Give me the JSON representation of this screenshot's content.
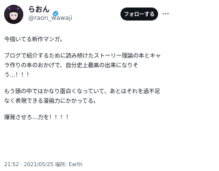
{
  "user": {
    "display_name": "らおん",
    "handle": "@raon_wawaji",
    "avatar_icon": "avatar-portrait-icon",
    "verified_icon": "verified-badge-icon"
  },
  "actions": {
    "follow_label": "フォローする",
    "more_icon": "more-options-icon"
  },
  "tweet": {
    "paragraphs": [
      "今描いてる新作マンガ。",
      "ブログで紹介するために読み続けたストーリー理論の本とキャラ作りの本のおかげで、自分史上最高の出来になりそう…！！！",
      "もう頭の中ではかなり面白くなっていて、あとはそれを過不足なく表現できる漫画力にかかってる。",
      "爆発させろ…力を！！！！"
    ]
  },
  "meta": {
    "time": "21:52",
    "date": "2021/05/25",
    "location_label": "場所:",
    "location": "Earth"
  },
  "colors": {
    "text": "#0f1419",
    "secondary": "#536471",
    "verified": "#1d9bf0",
    "follow_bg": "#0f1419",
    "follow_text": "#ffffff"
  }
}
